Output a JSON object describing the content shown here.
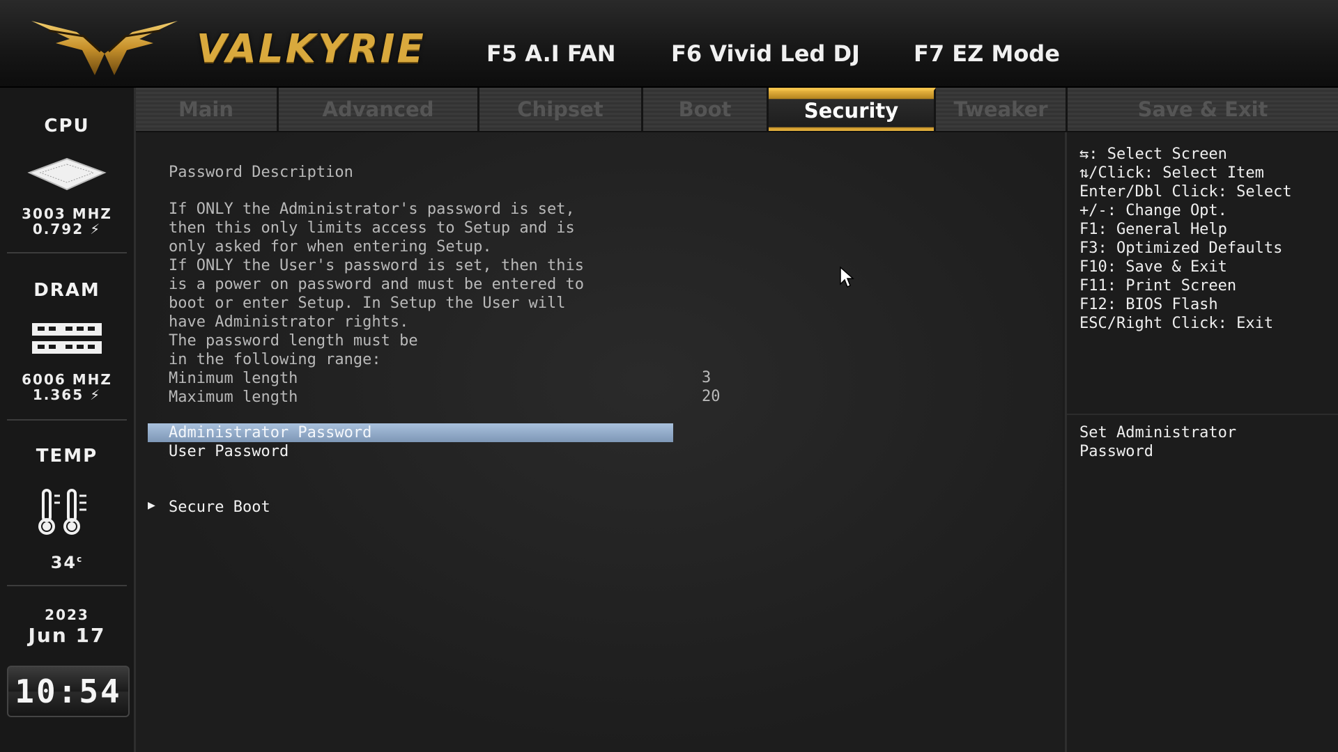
{
  "header": {
    "brand": "VALKYRIE",
    "hotkeys": [
      "F5 A.I FAN",
      "F6 Vivid Led DJ",
      "F7 EZ Mode"
    ]
  },
  "tabs": [
    {
      "label": "Main",
      "active": false
    },
    {
      "label": "Advanced",
      "active": false
    },
    {
      "label": "Chipset",
      "active": false
    },
    {
      "label": "Boot",
      "active": false
    },
    {
      "label": "Security",
      "active": true
    },
    {
      "label": "Tweaker",
      "active": false
    },
    {
      "label": "Save & Exit",
      "active": false
    }
  ],
  "sidebar": {
    "cpu": {
      "label": "CPU",
      "freq": "3003 MHZ",
      "volt": "0.792"
    },
    "dram": {
      "label": "DRAM",
      "freq": "6006 MHZ",
      "volt": "1.365"
    },
    "temp": {
      "label": "TEMP",
      "value": "34"
    },
    "date": {
      "year": "2023",
      "month_day": "Jun 17"
    },
    "time": "10:54"
  },
  "main": {
    "description_title": "Password Description",
    "description_lines": [
      "If ONLY the Administrator's password is set,",
      "then this only limits access to Setup and is",
      "only asked for when entering Setup.",
      "If ONLY the User's password is set, then this",
      "is a power on password and must be entered to",
      "boot or enter Setup. In Setup the User will",
      "have Administrator rights.",
      "The password length must be",
      "in the following range:"
    ],
    "min_label": "Minimum length",
    "min_value": "3",
    "max_label": "Maximum length",
    "max_value": "20",
    "admin_password": "Administrator Password",
    "user_password": "User Password",
    "secure_boot": "Secure Boot"
  },
  "help": {
    "keys": [
      ": Select Screen",
      "/Click: Select Item",
      "Enter/Dbl Click: Select",
      "+/-: Change Opt.",
      "F1: General Help",
      "F3: Optimized Defaults",
      "F10: Save & Exit",
      "F11: Print Screen",
      "F12: BIOS Flash",
      "ESC/Right Click: Exit"
    ],
    "item_help": [
      "Set Administrator",
      "Password"
    ]
  },
  "colors": {
    "accent": "#d9a93d",
    "selection": "#8fa8c8"
  }
}
